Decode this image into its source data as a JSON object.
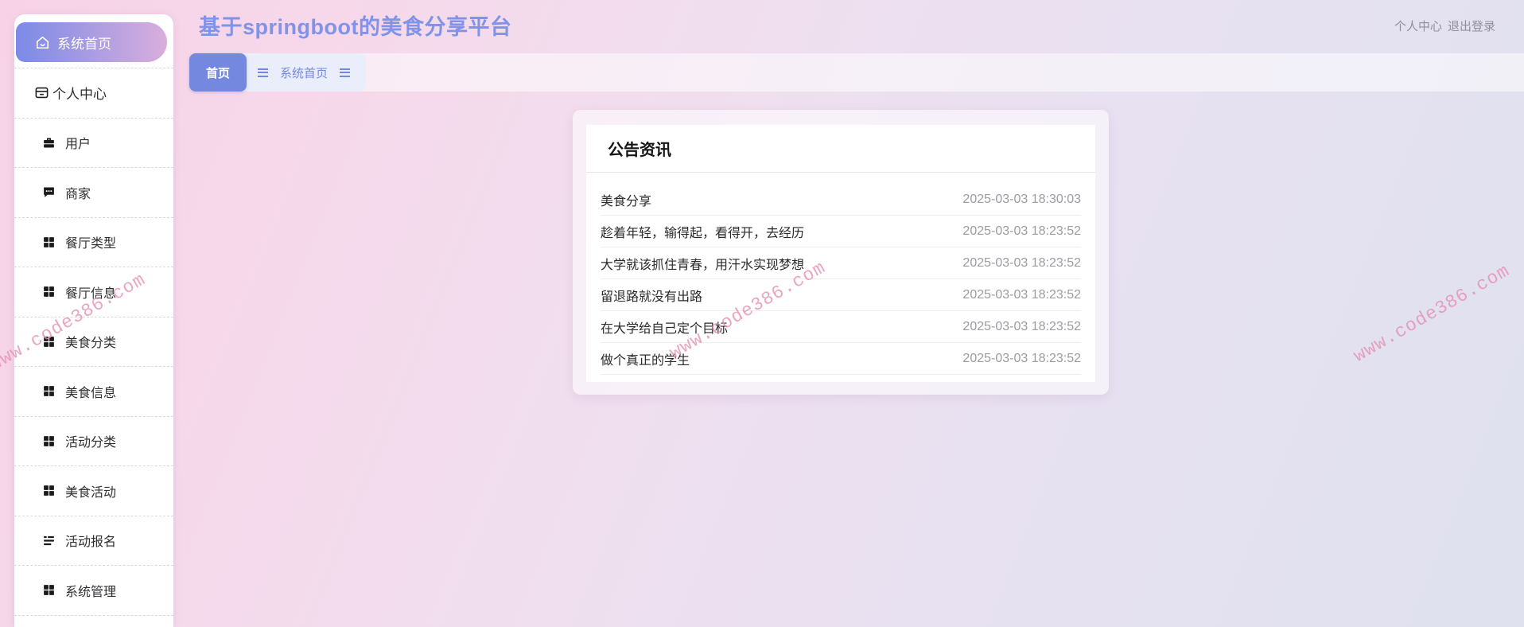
{
  "header": {
    "title": "基于springboot的美食分享平台",
    "profile_link": "个人中心",
    "logout_link": "退出登录"
  },
  "sidebar": {
    "home_label": "系统首页",
    "items": [
      {
        "id": "profile",
        "label": "个人中心",
        "icon": "card-icon",
        "variant": "profile"
      },
      {
        "id": "users",
        "label": "用户",
        "icon": "briefcase-icon"
      },
      {
        "id": "merchants",
        "label": "商家",
        "icon": "comment-icon"
      },
      {
        "id": "restaurant-type",
        "label": "餐厅类型",
        "icon": "grid-icon"
      },
      {
        "id": "restaurant-info",
        "label": "餐厅信息",
        "icon": "grid-icon"
      },
      {
        "id": "food-category",
        "label": "美食分类",
        "icon": "grid-icon"
      },
      {
        "id": "food-info",
        "label": "美食信息",
        "icon": "grid-icon"
      },
      {
        "id": "activity-category",
        "label": "活动分类",
        "icon": "grid-icon"
      },
      {
        "id": "food-activity",
        "label": "美食活动",
        "icon": "grid-icon"
      },
      {
        "id": "activity-signup",
        "label": "活动报名",
        "icon": "list-icon"
      },
      {
        "id": "system-management",
        "label": "系统管理",
        "icon": "grid-icon"
      }
    ]
  },
  "tabs": {
    "active_label": "首页",
    "breadcrumb": "系统首页"
  },
  "announcements": {
    "title": "公告资讯",
    "rows": [
      {
        "title": "美食分享",
        "date": "2025-03-03 18:30:03"
      },
      {
        "title": "趁着年轻，输得起，看得开，去经历",
        "date": "2025-03-03 18:23:52"
      },
      {
        "title": "大学就该抓住青春，用汗水实现梦想",
        "date": "2025-03-03 18:23:52"
      },
      {
        "title": "留退路就没有出路",
        "date": "2025-03-03 18:23:52"
      },
      {
        "title": "在大学给自己定个目标",
        "date": "2025-03-03 18:23:52"
      },
      {
        "title": "做个真正的学生",
        "date": "2025-03-03 18:23:52"
      }
    ]
  },
  "watermark": {
    "text": "www.code386.com"
  },
  "colors": {
    "accent": "#7488e0",
    "title": "#8093e8",
    "pill_start": "#7b8ae6",
    "pill_end": "#d9aedd",
    "watermark": "#e68fb2",
    "link_gray": "#8f8f9b",
    "date_gray": "#9b9ba3"
  }
}
